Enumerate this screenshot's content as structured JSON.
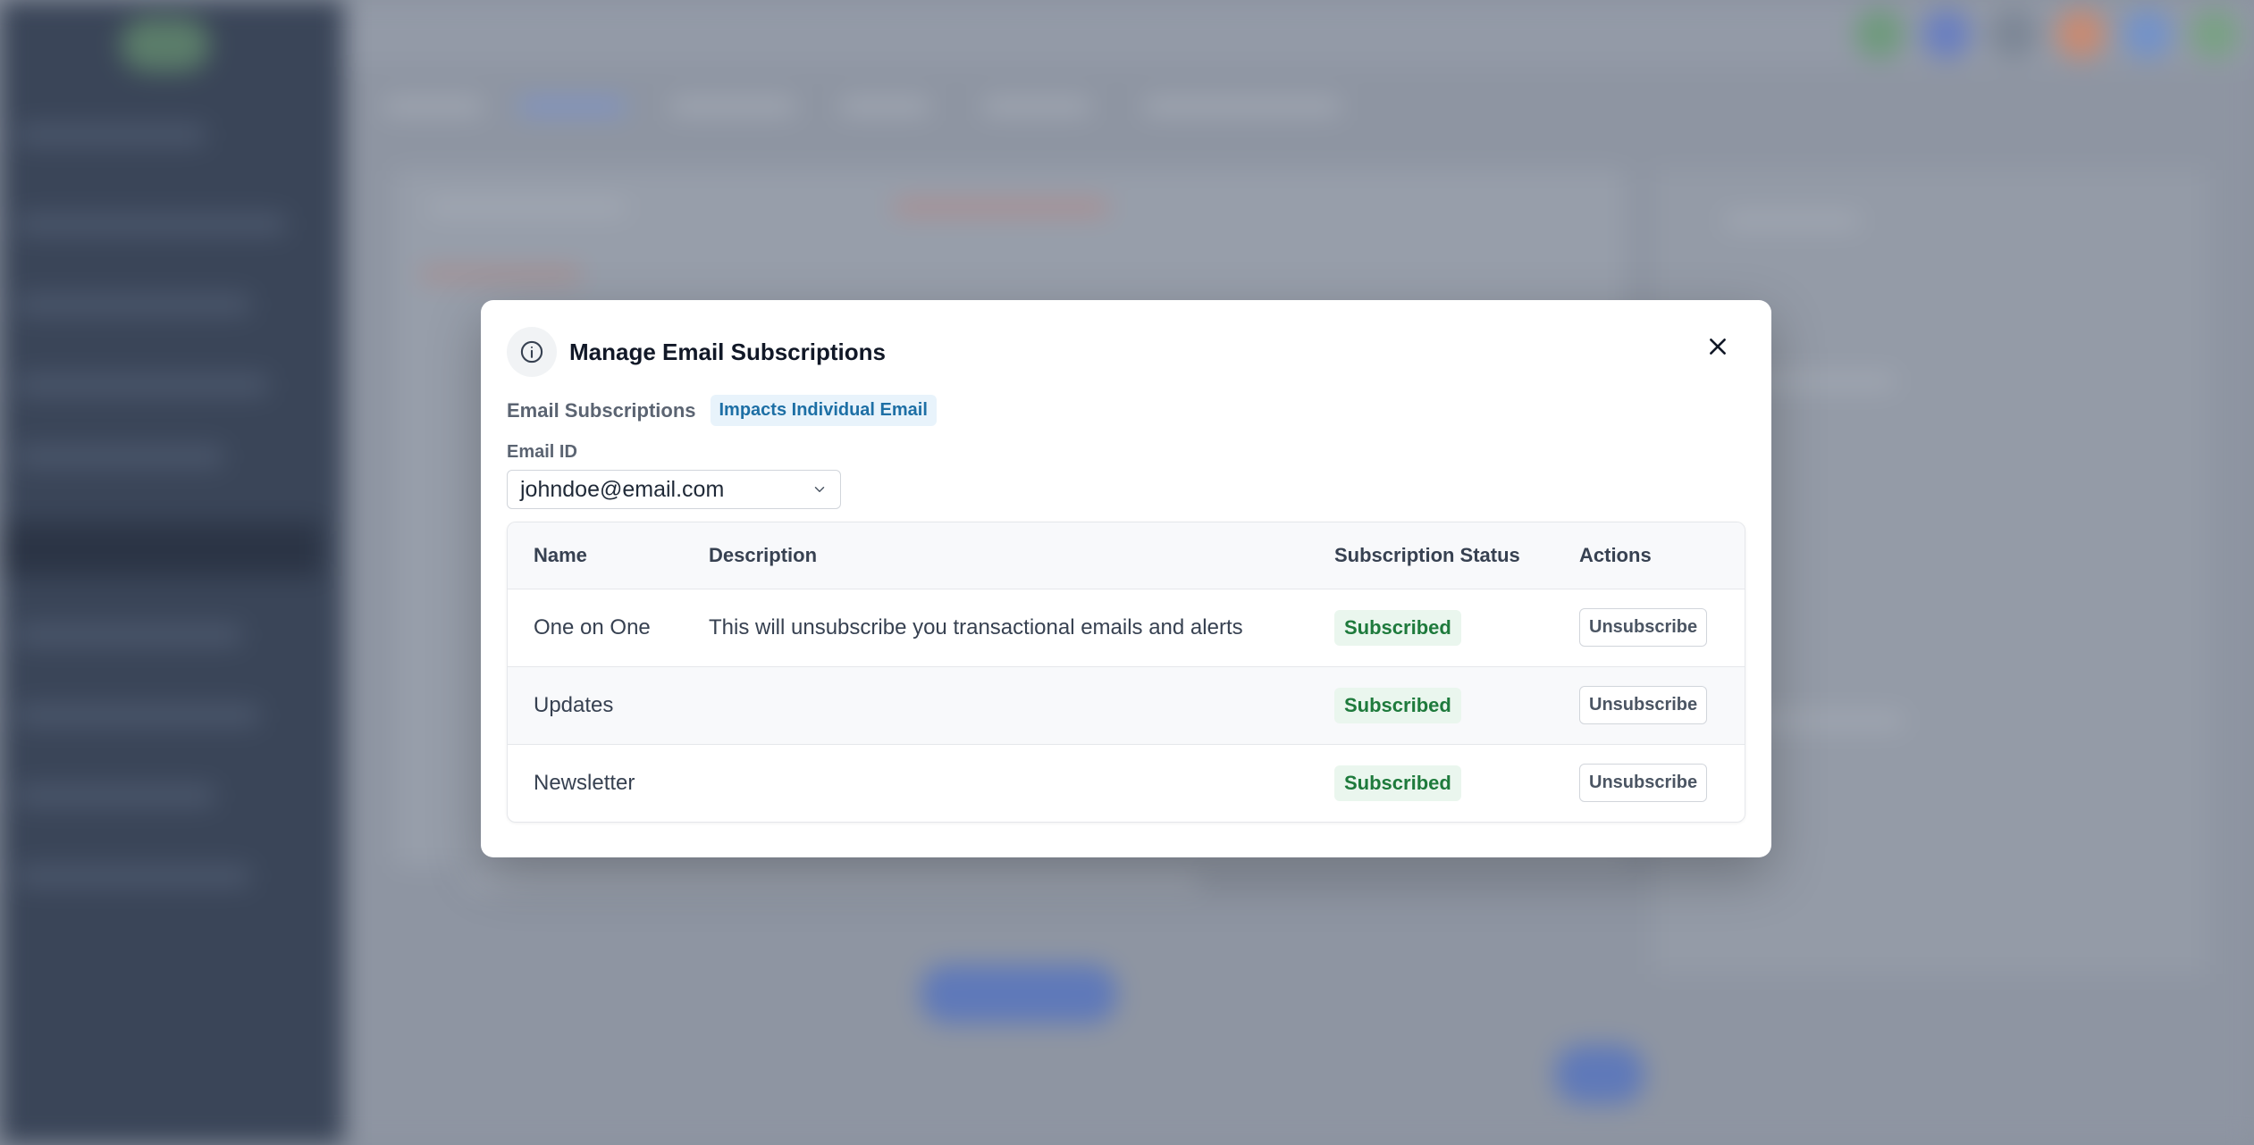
{
  "modal": {
    "title": "Manage Email Subscriptions",
    "info_icon": "info-icon",
    "close_icon": "close-icon",
    "section_label": "Email Subscriptions",
    "impact_badge": "Impacts Individual Email",
    "email_field": {
      "label": "Email ID",
      "value": "johndoe@email.com",
      "icon": "chevron-down-icon"
    },
    "table": {
      "headers": [
        "Name",
        "Description",
        "Subscription Status",
        "Actions"
      ],
      "rows": [
        {
          "name": "One on One",
          "description": "This will unsubscribe you transactional emails and alerts",
          "status": "Subscribed",
          "action": "Unsubscribe"
        },
        {
          "name": "Updates",
          "description": "",
          "status": "Subscribed",
          "action": "Unsubscribe"
        },
        {
          "name": "Newsletter",
          "description": "",
          "status": "Subscribed",
          "action": "Unsubscribe"
        }
      ]
    }
  },
  "colors": {
    "overlay": "#8b929f",
    "badge_info_bg": "#e8f3fb",
    "badge_info_text": "#1d6fa5",
    "status_bg": "#eaf6ee",
    "status_text": "#1e7a3c"
  }
}
